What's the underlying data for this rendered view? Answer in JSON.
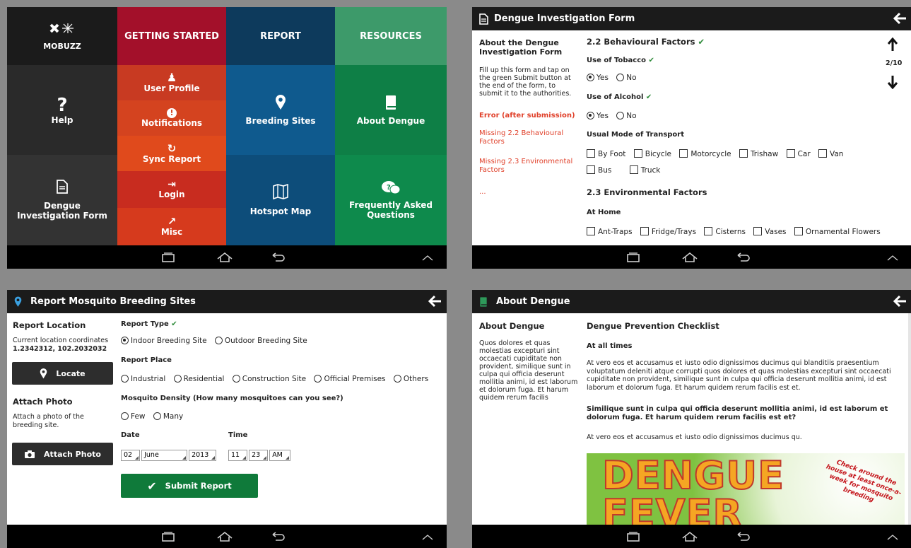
{
  "home": {
    "logo": "MOBUZZ",
    "col_headers": [
      "GETTING STARTED",
      "REPORT",
      "RESOURCES"
    ],
    "help": "Help",
    "dengue_form": "Dengue Investigation Form",
    "getting_started": [
      "User Profile",
      "Notifications",
      "Sync Report",
      "Login",
      "Misc"
    ],
    "report": [
      "Breeding Sites",
      "Hotspot Map"
    ],
    "resources": [
      "About Dengue",
      "Frequently Asked Questions"
    ],
    "colors": {
      "dark": "#1b1b1b",
      "red": "#a3102a",
      "orange": "#e24d1f",
      "navy": "#0d3a5c",
      "blue": "#0f5a8e",
      "green": "#0e8a4c",
      "green_light": "#3d9a6a"
    }
  },
  "form": {
    "title": "Dengue Investigation Form",
    "side_title": "About the Dengue Investigation Form",
    "side_text": "Fill up this form and tap on the green Submit button at the end of the form, to submit it to the authorities.",
    "error_title": "Error (after submission)",
    "errors": [
      "Missing 2.2 Behavioural Factors",
      "Missing 2.3 Environmental Factors",
      "..."
    ],
    "page": "2/10",
    "section_22": "2.2 Behavioural Factors",
    "tobacco": "Use of Tobacco",
    "alcohol": "Use of Alcohol",
    "yes": "Yes",
    "no": "No",
    "transport_label": "Usual Mode of Transport",
    "transport": [
      "By Foot",
      "Bicycle",
      "Motorcycle",
      "Trishaw",
      "Car",
      "Van",
      "Bus",
      "Truck"
    ],
    "section_23": "2.3 Environmental Factors",
    "at_home": "At Home",
    "home_items": [
      "Ant-Traps",
      "Fridge/Trays",
      "Cisterns",
      "Vases",
      "Ornamental Flowers"
    ]
  },
  "report": {
    "title": "Report Mosquito Breeding Sites",
    "location_title": "Report Location",
    "coords_label": "Current location coordinates",
    "coords": "1.2342312, 102.2032032",
    "locate": "Locate",
    "photo_title": "Attach Photo",
    "photo_text": "Attach a photo of the breeding site.",
    "attach_btn": "Attach Photo",
    "type_label": "Report Type",
    "types": [
      "Indoor Breeding Site",
      "Outdoor Breeding Site"
    ],
    "place_label": "Report Place",
    "places": [
      "Industrial",
      "Residential",
      "Construction Site",
      "Official Premises",
      "Others"
    ],
    "density_label": "Mosquito Density (How many mosquitoes can you see?)",
    "densities": [
      "Few",
      "Many"
    ],
    "date_label": "Date",
    "date_day": "02",
    "date_month": "June",
    "date_year": "2013",
    "time_label": "Time",
    "time_h": "11",
    "time_m": "23",
    "time_ampm": "AM",
    "submit": "Submit Report"
  },
  "about": {
    "title": "About Dengue",
    "side_title": "About Dengue",
    "side_text": "Quos dolores et quas molestias excepturi sint occaecati cupiditate non provident, similique sunt in culpa qui officia deserunt mollitia animi, id est laborum et dolorum fuga. Et harum quidem rerum facilis",
    "h1": "Dengue Prevention Checklist",
    "h2": "At all times",
    "p1": "At vero eos et accusamus et iusto odio dignissimos ducimus qui blanditiis praesentium voluptatum deleniti atque corrupti quos dolores et quas molestias excepturi sint occaecati cupiditate non provident, similique sunt in culpa qui officia deserunt mollitia animi, id est laborum et dolorum fuga. Et harum quidem rerum facilis est et.",
    "p2": "Similique sunt in culpa qui officia deserunt mollitia animi, id est laborum et dolorum fuga. Et harum quidem rerum facilis est et?",
    "p3": "At vero eos et accusamus et iusto odio dignissimos ducimus qu.",
    "banner_l1": "DENGUE",
    "banner_l2": "FEVER",
    "banner_side": "Check around the house at least once-a-week for mosquito breeding"
  }
}
